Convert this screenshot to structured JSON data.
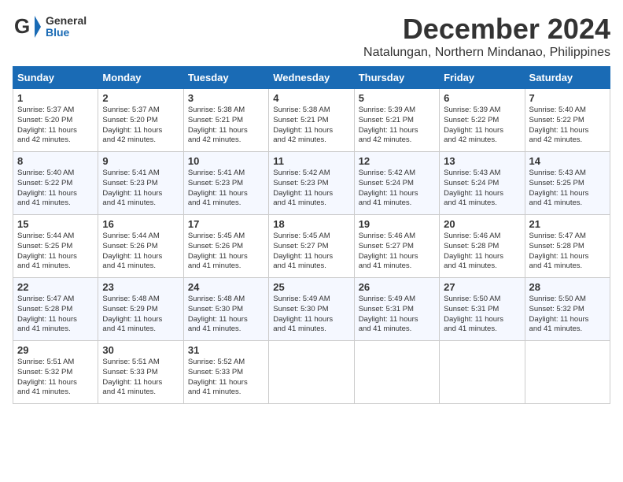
{
  "header": {
    "logo_general": "General",
    "logo_blue": "Blue",
    "month_title": "December 2024",
    "location": "Natalungan, Northern Mindanao, Philippines"
  },
  "weekdays": [
    "Sunday",
    "Monday",
    "Tuesday",
    "Wednesday",
    "Thursday",
    "Friday",
    "Saturday"
  ],
  "weeks": [
    [
      {
        "day": "1",
        "info": "Sunrise: 5:37 AM\nSunset: 5:20 PM\nDaylight: 11 hours\nand 42 minutes."
      },
      {
        "day": "2",
        "info": "Sunrise: 5:37 AM\nSunset: 5:20 PM\nDaylight: 11 hours\nand 42 minutes."
      },
      {
        "day": "3",
        "info": "Sunrise: 5:38 AM\nSunset: 5:21 PM\nDaylight: 11 hours\nand 42 minutes."
      },
      {
        "day": "4",
        "info": "Sunrise: 5:38 AM\nSunset: 5:21 PM\nDaylight: 11 hours\nand 42 minutes."
      },
      {
        "day": "5",
        "info": "Sunrise: 5:39 AM\nSunset: 5:21 PM\nDaylight: 11 hours\nand 42 minutes."
      },
      {
        "day": "6",
        "info": "Sunrise: 5:39 AM\nSunset: 5:22 PM\nDaylight: 11 hours\nand 42 minutes."
      },
      {
        "day": "7",
        "info": "Sunrise: 5:40 AM\nSunset: 5:22 PM\nDaylight: 11 hours\nand 42 minutes."
      }
    ],
    [
      {
        "day": "8",
        "info": "Sunrise: 5:40 AM\nSunset: 5:22 PM\nDaylight: 11 hours\nand 41 minutes."
      },
      {
        "day": "9",
        "info": "Sunrise: 5:41 AM\nSunset: 5:23 PM\nDaylight: 11 hours\nand 41 minutes."
      },
      {
        "day": "10",
        "info": "Sunrise: 5:41 AM\nSunset: 5:23 PM\nDaylight: 11 hours\nand 41 minutes."
      },
      {
        "day": "11",
        "info": "Sunrise: 5:42 AM\nSunset: 5:23 PM\nDaylight: 11 hours\nand 41 minutes."
      },
      {
        "day": "12",
        "info": "Sunrise: 5:42 AM\nSunset: 5:24 PM\nDaylight: 11 hours\nand 41 minutes."
      },
      {
        "day": "13",
        "info": "Sunrise: 5:43 AM\nSunset: 5:24 PM\nDaylight: 11 hours\nand 41 minutes."
      },
      {
        "day": "14",
        "info": "Sunrise: 5:43 AM\nSunset: 5:25 PM\nDaylight: 11 hours\nand 41 minutes."
      }
    ],
    [
      {
        "day": "15",
        "info": "Sunrise: 5:44 AM\nSunset: 5:25 PM\nDaylight: 11 hours\nand 41 minutes."
      },
      {
        "day": "16",
        "info": "Sunrise: 5:44 AM\nSunset: 5:26 PM\nDaylight: 11 hours\nand 41 minutes."
      },
      {
        "day": "17",
        "info": "Sunrise: 5:45 AM\nSunset: 5:26 PM\nDaylight: 11 hours\nand 41 minutes."
      },
      {
        "day": "18",
        "info": "Sunrise: 5:45 AM\nSunset: 5:27 PM\nDaylight: 11 hours\nand 41 minutes."
      },
      {
        "day": "19",
        "info": "Sunrise: 5:46 AM\nSunset: 5:27 PM\nDaylight: 11 hours\nand 41 minutes."
      },
      {
        "day": "20",
        "info": "Sunrise: 5:46 AM\nSunset: 5:28 PM\nDaylight: 11 hours\nand 41 minutes."
      },
      {
        "day": "21",
        "info": "Sunrise: 5:47 AM\nSunset: 5:28 PM\nDaylight: 11 hours\nand 41 minutes."
      }
    ],
    [
      {
        "day": "22",
        "info": "Sunrise: 5:47 AM\nSunset: 5:28 PM\nDaylight: 11 hours\nand 41 minutes."
      },
      {
        "day": "23",
        "info": "Sunrise: 5:48 AM\nSunset: 5:29 PM\nDaylight: 11 hours\nand 41 minutes."
      },
      {
        "day": "24",
        "info": "Sunrise: 5:48 AM\nSunset: 5:30 PM\nDaylight: 11 hours\nand 41 minutes."
      },
      {
        "day": "25",
        "info": "Sunrise: 5:49 AM\nSunset: 5:30 PM\nDaylight: 11 hours\nand 41 minutes."
      },
      {
        "day": "26",
        "info": "Sunrise: 5:49 AM\nSunset: 5:31 PM\nDaylight: 11 hours\nand 41 minutes."
      },
      {
        "day": "27",
        "info": "Sunrise: 5:50 AM\nSunset: 5:31 PM\nDaylight: 11 hours\nand 41 minutes."
      },
      {
        "day": "28",
        "info": "Sunrise: 5:50 AM\nSunset: 5:32 PM\nDaylight: 11 hours\nand 41 minutes."
      }
    ],
    [
      {
        "day": "29",
        "info": "Sunrise: 5:51 AM\nSunset: 5:32 PM\nDaylight: 11 hours\nand 41 minutes."
      },
      {
        "day": "30",
        "info": "Sunrise: 5:51 AM\nSunset: 5:33 PM\nDaylight: 11 hours\nand 41 minutes."
      },
      {
        "day": "31",
        "info": "Sunrise: 5:52 AM\nSunset: 5:33 PM\nDaylight: 11 hours\nand 41 minutes."
      },
      {
        "day": "",
        "info": ""
      },
      {
        "day": "",
        "info": ""
      },
      {
        "day": "",
        "info": ""
      },
      {
        "day": "",
        "info": ""
      }
    ]
  ]
}
